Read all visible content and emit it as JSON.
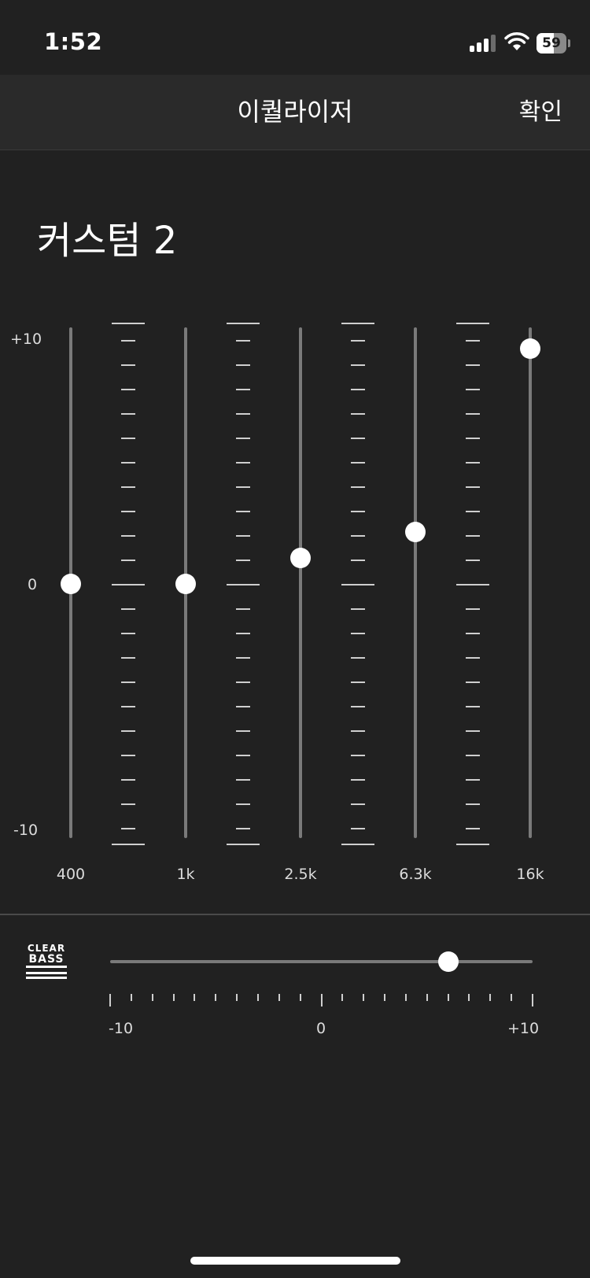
{
  "status_bar": {
    "time": "1:52",
    "battery_level": "59",
    "signal_bars": 3
  },
  "nav": {
    "title": "이퀄라이저",
    "confirm_label": "확인"
  },
  "preset": {
    "name": "커스텀 2"
  },
  "equalizer": {
    "scale": {
      "max_label": "+10",
      "mid_label": "0",
      "min_label": "-10",
      "min": -10,
      "max": 10
    },
    "bands": [
      {
        "freq": "400",
        "value": 0
      },
      {
        "freq": "1k",
        "value": 0
      },
      {
        "freq": "2.5k",
        "value": 1
      },
      {
        "freq": "6.3k",
        "value": 2
      },
      {
        "freq": "16k",
        "value": 9
      }
    ]
  },
  "clear_bass": {
    "logo_top": "CLEAR",
    "logo_bottom": "BASS",
    "value": 6,
    "min": -10,
    "max": 10,
    "min_label": "-10",
    "mid_label": "0",
    "max_label": "+10"
  },
  "colors": {
    "background": "#212121",
    "nav_background": "#2a2a2a",
    "track": "#7a7a7a",
    "knob": "#ffffff"
  }
}
